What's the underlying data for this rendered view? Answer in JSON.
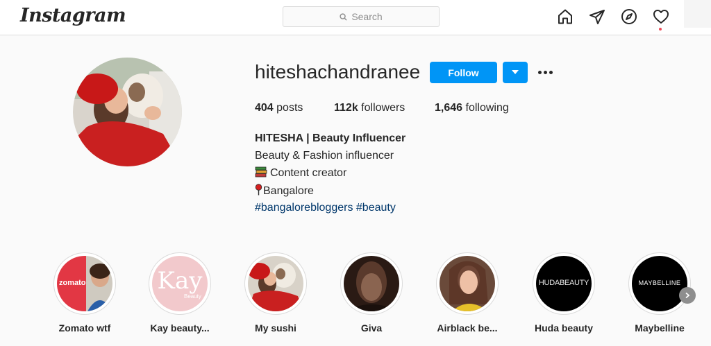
{
  "header": {
    "logo": "Instagram",
    "search_placeholder": "Search"
  },
  "nav_icons": [
    "home-icon",
    "direct-send-icon",
    "explore-compass-icon",
    "activity-heart-icon"
  ],
  "profile": {
    "username": "hiteshachandranee",
    "follow_label": "Follow",
    "posts_count": "404",
    "posts_label": "posts",
    "followers_count": "112k",
    "followers_label": "followers",
    "following_count": "1,646",
    "following_label": "following",
    "bio_name": "HITESHA | Beauty Influencer",
    "bio_line1": "Beauty & Fashion influencer",
    "bio_line2": "Content creator",
    "bio_line3": "Bangalore",
    "bio_tags": "#bangalorebloggers #beauty"
  },
  "highlights": [
    {
      "label": "Zomato wtf",
      "brand_text": "zomato"
    },
    {
      "label": "Kay beauty...",
      "brand_text": "Kay",
      "brand_sub": "Beauty"
    },
    {
      "label": "My sushi"
    },
    {
      "label": "Giva"
    },
    {
      "label": "Airblack be..."
    },
    {
      "label": "Huda beauty",
      "brand_text": "HUDABEAUTY"
    },
    {
      "label": "Maybelline",
      "brand_text": "MAYBELLINE"
    }
  ],
  "colors": {
    "primary_blue": "#0095f6",
    "link_blue": "#00376b",
    "notification_red": "#ed4956",
    "border": "#dbdbdb",
    "background": "#fafafa"
  }
}
